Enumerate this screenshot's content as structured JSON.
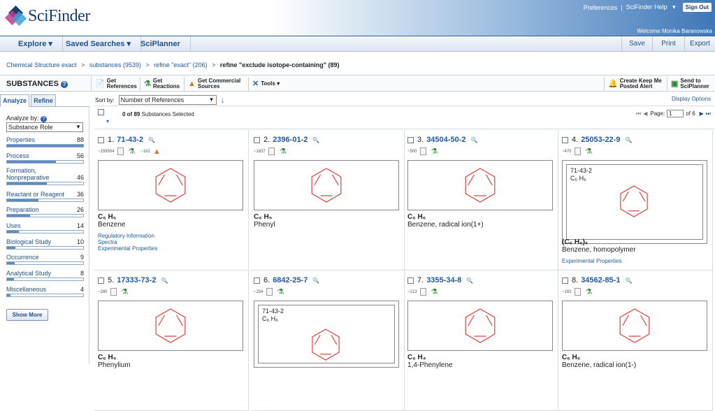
{
  "header": {
    "brand": "SciFinder",
    "preferences": "Preferences",
    "separator": "|",
    "help": "SciFinder Help",
    "sign_out": "Sign Out",
    "welcome": "Welcome Monika Baranowska"
  },
  "nav": {
    "explore": "Explore",
    "saved_searches": "Saved Searches",
    "sciplanner": "SciPlanner",
    "save": "Save",
    "print": "Print",
    "export": "Export"
  },
  "breadcrumb": [
    "Chemical Structure exact",
    "substances (9539)",
    "refine \"exact\" (206)",
    "refine \"exclude isotope-containing\" (89)"
  ],
  "breadcrumb_sep": ">",
  "toolbar": {
    "title": "SUBSTANCES",
    "get_references": [
      "Get",
      "References"
    ],
    "get_reactions": [
      "Get",
      "Reactions"
    ],
    "get_commercial": [
      "Get Commercial",
      "Sources"
    ],
    "tools": "Tools",
    "keep_me_posted": [
      "Create Keep Me",
      "Posted Alert"
    ],
    "send_to": [
      "Send to",
      "SciPlanner"
    ]
  },
  "left": {
    "tab_analyze": "Analyze",
    "tab_refine": "Refine",
    "analyze_by": "Analyze by:",
    "analyze_select": "Substance Role",
    "rows": [
      {
        "label": "Properties",
        "count": "88",
        "fill": 1.0
      },
      {
        "label": "Process",
        "count": "56",
        "fill": 0.64
      },
      {
        "label": "Formation, Nonpreparative",
        "count": "46",
        "fill": 0.52
      },
      {
        "label": "Reactant or Reagent",
        "count": "36",
        "fill": 0.41
      },
      {
        "label": "Preparation",
        "count": "26",
        "fill": 0.3
      },
      {
        "label": "Uses",
        "count": "14",
        "fill": 0.16
      },
      {
        "label": "Biological Study",
        "count": "10",
        "fill": 0.11
      },
      {
        "label": "Occurrence",
        "count": "9",
        "fill": 0.1
      },
      {
        "label": "Analytical Study",
        "count": "8",
        "fill": 0.09
      },
      {
        "label": "Miscellaneous",
        "count": "4",
        "fill": 0.05
      }
    ],
    "show_more": "Show More"
  },
  "list": {
    "sort_by_label": "Sort by:",
    "sort_value": "Number of References",
    "display_options": "Display Options",
    "selected": "0 of 89",
    "selected_suffix": "Substances Selected",
    "page_label": "Page:",
    "page_value": "1",
    "page_of": "of 6"
  },
  "substances": [
    {
      "num": "1.",
      "cas": "71-43-2",
      "refs": "~159504",
      "rx": "~162",
      "formula": "C₆ H₆",
      "name": "Benzene",
      "links": [
        "Regulatory Information",
        "Spectra",
        "Experimental Properties"
      ]
    },
    {
      "num": "2.",
      "cas": "2396-01-2",
      "refs": "~1637",
      "rx": "",
      "formula": "C₆ H₅",
      "name": "Phenyl",
      "links": []
    },
    {
      "num": "3.",
      "cas": "34504-50-2",
      "refs": "~500",
      "rx": "",
      "formula": "C₆ H₆",
      "name": "Benzene, radical ion(1+)",
      "links": []
    },
    {
      "num": "4.",
      "cas": "25053-22-9",
      "refs": "~470",
      "rx": "",
      "formula": "(C₆ H₆)ₓ",
      "name": "Benzene, homopolymer",
      "links": [
        "Experimental Properties"
      ],
      "inner": [
        "71-43-2",
        "C₆ H₆"
      ]
    },
    {
      "num": "5.",
      "cas": "17333-73-2",
      "refs": "~280",
      "rx": "",
      "formula": "C₆ H₅",
      "name": "Phenylium",
      "links": []
    },
    {
      "num": "6.",
      "cas": "6842-25-7",
      "refs": "~254",
      "rx": "",
      "formula": "",
      "name": "",
      "links": [],
      "inner": [
        "71-43-2",
        "C₆ H₆"
      ]
    },
    {
      "num": "7.",
      "cas": "3355-34-8",
      "refs": "~213",
      "rx": "",
      "formula": "C₆ H₄",
      "name": "1,4-Phenylene",
      "links": []
    },
    {
      "num": "8.",
      "cas": "34562-85-1",
      "refs": "~183",
      "rx": "",
      "formula": "C₆ H₆",
      "name": "Benzene, radical ion(1-)",
      "links": []
    }
  ],
  "colors": {
    "structure": "#e0403a",
    "link": "#1f5aa0",
    "nav_text": "#1f4f8b"
  }
}
